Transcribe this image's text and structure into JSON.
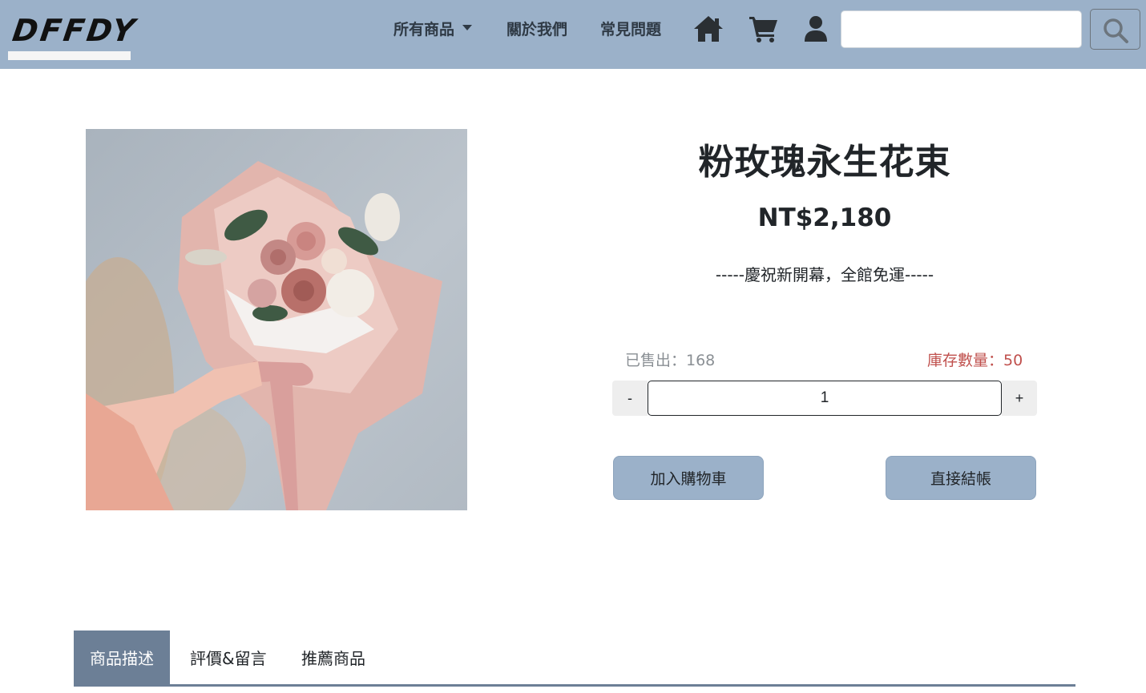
{
  "brand": {
    "logo_text": "DFFDY"
  },
  "nav": {
    "all_products": "所有商品",
    "about": "關於我們",
    "faq": "常見問題",
    "icons": [
      "home-icon",
      "cart-icon",
      "user-icon",
      "search-icon"
    ]
  },
  "search": {
    "value": "",
    "placeholder": ""
  },
  "product": {
    "title": "粉玫瑰永生花束",
    "price": "NT$2,180",
    "promo": "-----慶祝新開幕，全館免運-----",
    "sold_label": "已售出：168",
    "stock_label": "庫存數量：50",
    "quantity": "1",
    "minus_label": "-",
    "plus_label": "+",
    "add_to_cart": "加入購物車",
    "checkout": "直接結帳"
  },
  "tabs": [
    {
      "label": "商品描述",
      "active": true
    },
    {
      "label": "評價&留言",
      "active": false
    },
    {
      "label": "推薦商品",
      "active": false
    }
  ],
  "colors": {
    "navbar": "#9bb1c9",
    "active_tab": "#6c7f96",
    "stock_text": "#c0504d",
    "sold_text": "#8a8f94"
  }
}
